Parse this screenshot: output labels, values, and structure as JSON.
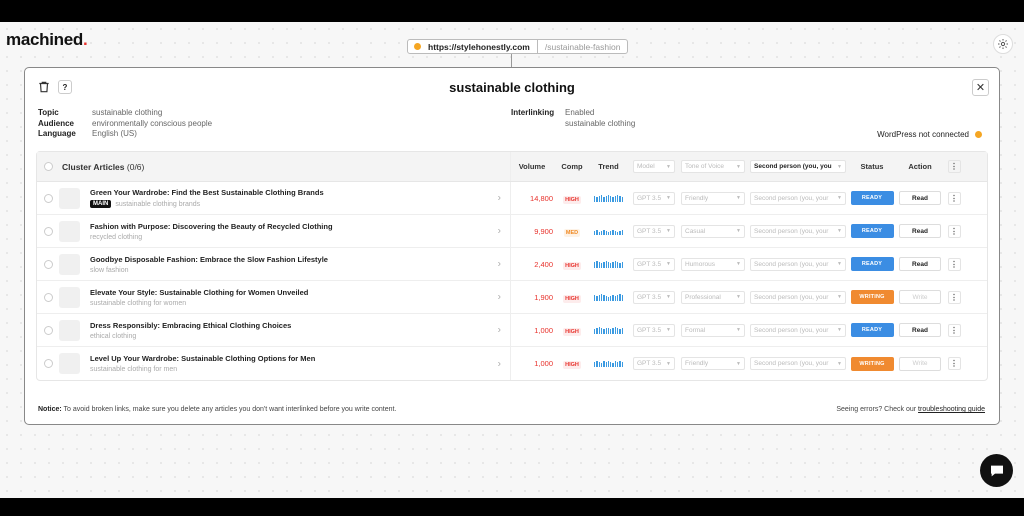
{
  "app": {
    "logo_text": "machined",
    "logo_dot": ".",
    "brand_color": "#e8322c"
  },
  "url": {
    "domain": "https://stylehonestly.com",
    "path": "/sustainable-fashion"
  },
  "panel": {
    "title": "sustainable clothing",
    "help_label": "?",
    "close_label": "✕",
    "meta_left": [
      {
        "key": "Topic",
        "value": "sustainable clothing"
      },
      {
        "key": "Audience",
        "value": "environmentally conscious people"
      },
      {
        "key": "Language",
        "value": "English (US)"
      }
    ],
    "interlinking": {
      "key": "Interlinking",
      "value1": "Enabled",
      "value2": "sustainable clothing"
    },
    "wordpress_status": "WordPress not connected"
  },
  "table": {
    "headers": {
      "cluster": "Cluster Articles",
      "count": "(0/6)",
      "volume": "Volume",
      "comp": "Comp",
      "trend": "Trend",
      "model": "Model",
      "tone": "Tone of Voice",
      "person": "Second person (you, you",
      "status": "Status",
      "action": "Action"
    },
    "rows": [
      {
        "title": "Green Your Wardrobe: Find the Best Sustainable Clothing Brands",
        "keyword": "sustainable clothing brands",
        "main": "MAIN",
        "volume": "14,800",
        "comp": "HIGH",
        "model": "GPT 3.5",
        "tone": "Friendly",
        "person": "Second person (you, your",
        "status": "READY",
        "action": "Read"
      },
      {
        "title": "Fashion with Purpose: Discovering the Beauty of Recycled Clothing",
        "keyword": "recycled clothing",
        "volume": "9,900",
        "comp": "MED",
        "model": "GPT 3.5",
        "tone": "Casual",
        "person": "Second person (you, your",
        "status": "READY",
        "action": "Read"
      },
      {
        "title": "Goodbye Disposable Fashion: Embrace the Slow Fashion Lifestyle",
        "keyword": "slow fashion",
        "volume": "2,400",
        "comp": "HIGH",
        "model": "GPT 3.5",
        "tone": "Humorous",
        "person": "Second person (you, your",
        "status": "READY",
        "action": "Read"
      },
      {
        "title": "Elevate Your Style: Sustainable Clothing for Women Unveiled",
        "keyword": "sustainable clothing for women",
        "volume": "1,900",
        "comp": "HIGH",
        "model": "GPT 3.5",
        "tone": "Professional",
        "person": "Second person (you, your",
        "status": "WRITING",
        "action": "Write"
      },
      {
        "title": "Dress Responsibly: Embracing Ethical Clothing Choices",
        "keyword": "ethical clothing",
        "volume": "1,000",
        "comp": "HIGH",
        "model": "GPT 3.5",
        "tone": "Formal",
        "person": "Second person (you, your",
        "status": "READY",
        "action": "Read"
      },
      {
        "title": "Level Up Your Wardrobe: Sustainable Clothing Options for Men",
        "keyword": "sustainable clothing for men",
        "volume": "1,000",
        "comp": "HIGH",
        "model": "GPT 3.5",
        "tone": "Friendly",
        "person": "Second person (you, your",
        "status": "WRITING",
        "action": "Write"
      }
    ]
  },
  "footer": {
    "notice_label": "Notice:",
    "notice_text": " To avoid broken links, make sure you delete any articles you don't want interlinked before you write content.",
    "errors_text": "Seeing errors? Check our ",
    "errors_link": "troubleshooting guide"
  },
  "colors": {
    "ready": "#3b8de3",
    "writing": "#f08a30",
    "warning_dot": "#f5a623"
  }
}
